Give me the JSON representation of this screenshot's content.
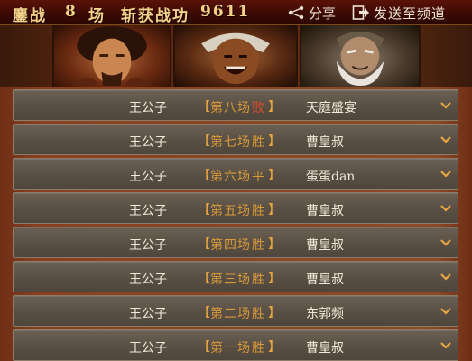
{
  "header": {
    "fight_label": "鏖战",
    "fight_count": "8",
    "field_label": "场",
    "merit_label": "斩获战功",
    "merit_value": "9611",
    "share_label": "分享",
    "send_label": "发送至频道"
  },
  "portraits": [
    {
      "icon": "warrior-portrait-icon"
    },
    {
      "icon": "laughing-warrior-portrait-icon"
    },
    {
      "icon": "old-sage-portrait-icon"
    }
  ],
  "records": [
    {
      "player": "王公子",
      "round": "第八场",
      "result": "败",
      "opponent": "天庭盛宴"
    },
    {
      "player": "王公子",
      "round": "第七场",
      "result": "胜",
      "opponent": "曹皇叔"
    },
    {
      "player": "王公子",
      "round": "第六场",
      "result": "平",
      "opponent": "蛋蛋dan"
    },
    {
      "player": "王公子",
      "round": "第五场",
      "result": "胜",
      "opponent": "曹皇叔"
    },
    {
      "player": "王公子",
      "round": "第四场",
      "result": "胜",
      "opponent": "曹皇叔"
    },
    {
      "player": "王公子",
      "round": "第三场",
      "result": "胜",
      "opponent": "曹皇叔"
    },
    {
      "player": "王公子",
      "round": "第二场",
      "result": "胜",
      "opponent": "东郭频"
    },
    {
      "player": "王公子",
      "round": "第一场",
      "result": "胜",
      "opponent": "曹皇叔"
    }
  ],
  "colors": {
    "win": "#d99a3a",
    "lose": "#e04a2a",
    "accent": "#f3d38a"
  }
}
